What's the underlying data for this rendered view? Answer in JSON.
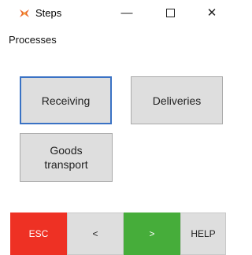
{
  "window": {
    "title": "Steps",
    "minimize_glyph": "—",
    "close_glyph": "✕"
  },
  "section": {
    "label": "Processes"
  },
  "tiles": [
    {
      "label": "Receiving",
      "focused": true
    },
    {
      "label": "Deliveries",
      "focused": false
    },
    {
      "label": "Goods\ntransport",
      "focused": false
    }
  ],
  "actions": {
    "esc": "ESC",
    "prev": "<",
    "next": ">",
    "help": "HELP"
  },
  "colors": {
    "esc": "#ee3124",
    "next": "#46ad3a",
    "tile": "#dedede",
    "focus": "#3a72c4"
  },
  "icons": {
    "app": "steps-app-icon",
    "minimize": "minimize-icon",
    "maximize": "maximize-icon",
    "close": "close-icon"
  }
}
